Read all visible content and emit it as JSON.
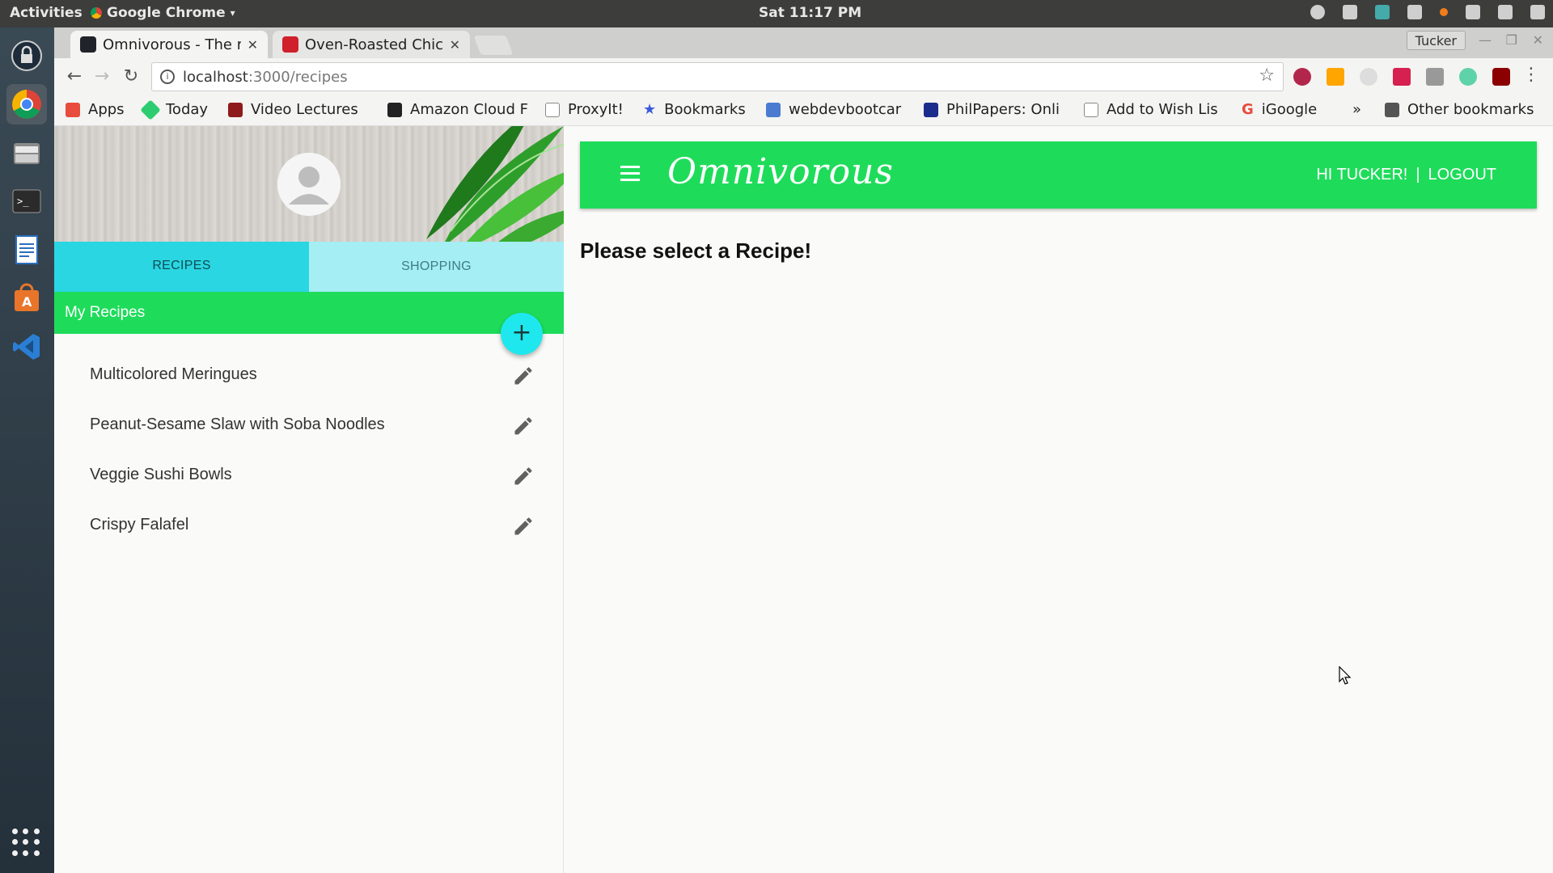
{
  "os": {
    "activities": "Activities",
    "app_menu": "Google Chrome",
    "clock": "Sat 11:17 PM"
  },
  "browser": {
    "tabs": [
      {
        "title": "Omnivorous - The r",
        "active": true
      },
      {
        "title": "Oven-Roasted Chick",
        "active": false
      }
    ],
    "profile": "Tucker",
    "url_host": "localhost",
    "url_path": ":3000/recipes",
    "bookmarks": [
      {
        "label": "Apps",
        "icon": "apps-grid-icon",
        "color": "#e74c3c"
      },
      {
        "label": "Today",
        "icon": "today-icon",
        "color": "#2ecc71"
      },
      {
        "label": "Video Lectures",
        "icon": "video-lectures-icon",
        "color": "#8e1b1b"
      },
      {
        "label": "Amazon Cloud F",
        "icon": "amazon-icon",
        "color": "#222222"
      },
      {
        "label": "ProxyIt!",
        "icon": "page-icon",
        "color": "#aaaaaa"
      },
      {
        "label": "Bookmarks",
        "icon": "star-icon",
        "color": "#3b5bdb"
      },
      {
        "label": "webdevbootcar",
        "icon": "webdev-icon",
        "color": "#4a7bd0"
      },
      {
        "label": "PhilPapers: Onli",
        "icon": "philpapers-icon",
        "color": "#1c2c8c"
      },
      {
        "label": "Add to Wish Lis",
        "icon": "page-icon",
        "color": "#aaaaaa"
      },
      {
        "label": "iGoogle",
        "icon": "google-icon",
        "color": "#e74c3c"
      }
    ],
    "more_bookmarks": "»",
    "other_bookmarks": "Other bookmarks"
  },
  "app": {
    "brand": "Omnivorous",
    "greeting": "HI TUCKER!",
    "separator": "|",
    "logout": "LOGOUT",
    "tabs": [
      "RECIPES",
      "SHOPPING"
    ],
    "section_title": "My Recipes",
    "add_symbol": "+",
    "recipes": [
      "Multicolored Meringues",
      "Peanut-Sesame Slaw with Soba Noodles",
      "Veggie Sushi Bowls",
      "Crispy Falafel"
    ],
    "empty_message": "Please select a Recipe!"
  },
  "colors": {
    "accent_green": "#1edc5a",
    "accent_cyan": "#2ad6e2"
  }
}
